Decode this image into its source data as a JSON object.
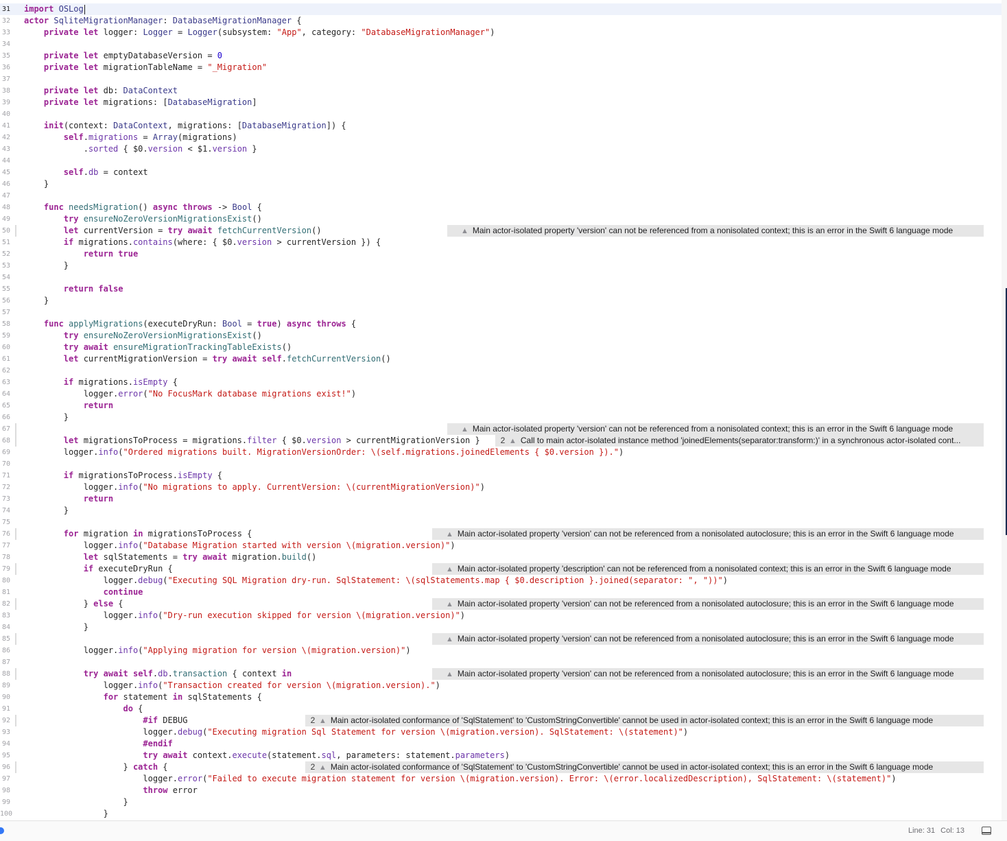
{
  "editor": {
    "current_line": 31,
    "lines": [
      {
        "n": 31,
        "t": "import OSLog",
        "cur": true
      },
      {
        "n": 32,
        "t": "actor SqliteMigrationManager: DatabaseMigrationManager {"
      },
      {
        "n": 33,
        "t": "    private let logger: Logger = Logger(subsystem: \"App\", category: \"DatabaseMigrationManager\")"
      },
      {
        "n": 34,
        "t": ""
      },
      {
        "n": 35,
        "t": "    private let emptyDatabaseVersion = 0"
      },
      {
        "n": 36,
        "t": "    private let migrationTableName = \"_Migration\""
      },
      {
        "n": 37,
        "t": ""
      },
      {
        "n": 38,
        "t": "    private let db: DataContext"
      },
      {
        "n": 39,
        "t": "    private let migrations: [DatabaseMigration]"
      },
      {
        "n": 40,
        "t": ""
      },
      {
        "n": 41,
        "t": "    init(context: DataContext, migrations: [DatabaseMigration]) {"
      },
      {
        "n": 42,
        "t": "        self.migrations = Array(migrations)"
      },
      {
        "n": 43,
        "t": "            .sorted { $0.version < $1.version }"
      },
      {
        "n": 44,
        "t": ""
      },
      {
        "n": 45,
        "t": "        self.db = context"
      },
      {
        "n": 46,
        "t": "    }"
      },
      {
        "n": 47,
        "t": ""
      },
      {
        "n": 48,
        "t": "    func needsMigration() async throws -> Bool {"
      },
      {
        "n": 49,
        "t": "        try ensureNoZeroVersionMigrationsExist()"
      },
      {
        "n": 50,
        "t": "        let currentVersion = try await fetchCurrentVersion()"
      },
      {
        "n": 51,
        "t": "        if migrations.contains(where: { $0.version > currentVersion }) {"
      },
      {
        "n": 52,
        "t": "            return true"
      },
      {
        "n": 53,
        "t": "        }"
      },
      {
        "n": 54,
        "t": ""
      },
      {
        "n": 55,
        "t": "        return false"
      },
      {
        "n": 56,
        "t": "    }"
      },
      {
        "n": 57,
        "t": ""
      },
      {
        "n": 58,
        "t": "    func applyMigrations(executeDryRun: Bool = true) async throws {"
      },
      {
        "n": 59,
        "t": "        try ensureNoZeroVersionMigrationsExist()"
      },
      {
        "n": 60,
        "t": "        try await ensureMigrationTrackingTableExists()"
      },
      {
        "n": 61,
        "t": "        let currentMigrationVersion = try await self.fetchCurrentVersion()"
      },
      {
        "n": 62,
        "t": ""
      },
      {
        "n": 63,
        "t": "        if migrations.isEmpty {"
      },
      {
        "n": 64,
        "t": "            logger.error(\"No FocusMark database migrations exist!\")"
      },
      {
        "n": 65,
        "t": "            return"
      },
      {
        "n": 66,
        "t": "        }"
      },
      {
        "n": 67,
        "t": ""
      },
      {
        "n": 68,
        "t": "        let migrationsToProcess = migrations.filter { $0.version > currentMigrationVersion }"
      },
      {
        "n": 69,
        "t": "        logger.info(\"Ordered migrations built. MigrationVersionOrder: \\(self.migrations.joinedElements { $0.version }).\")"
      },
      {
        "n": 70,
        "t": ""
      },
      {
        "n": 71,
        "t": "        if migrationsToProcess.isEmpty {"
      },
      {
        "n": 72,
        "t": "            logger.info(\"No migrations to apply. CurrentVersion: \\(currentMigrationVersion)\")"
      },
      {
        "n": 73,
        "t": "            return"
      },
      {
        "n": 74,
        "t": "        }"
      },
      {
        "n": 75,
        "t": ""
      },
      {
        "n": 76,
        "t": "        for migration in migrationsToProcess {"
      },
      {
        "n": 77,
        "t": "            logger.info(\"Database Migration started with version \\(migration.version)\")"
      },
      {
        "n": 78,
        "t": "            let sqlStatements = try await migration.build()"
      },
      {
        "n": 79,
        "t": "            if executeDryRun {"
      },
      {
        "n": 80,
        "t": "                logger.debug(\"Executing SQL Migration dry-run. SqlStatement: \\(sqlStatements.map { $0.description }.joined(separator: \", \"))\")"
      },
      {
        "n": 81,
        "t": "                continue"
      },
      {
        "n": 82,
        "t": "            } else {"
      },
      {
        "n": 83,
        "t": "                logger.info(\"Dry-run execution skipped for version \\(migration.version)\")"
      },
      {
        "n": 84,
        "t": "            }"
      },
      {
        "n": 85,
        "t": ""
      },
      {
        "n": 86,
        "t": "            logger.info(\"Applying migration for version \\(migration.version)\")"
      },
      {
        "n": 87,
        "t": ""
      },
      {
        "n": 88,
        "t": "            try await self.db.transaction { context in"
      },
      {
        "n": 89,
        "t": "                logger.info(\"Transaction created for version \\(migration.version).\")"
      },
      {
        "n": 90,
        "t": "                for statement in sqlStatements {"
      },
      {
        "n": 91,
        "t": "                    do {"
      },
      {
        "n": 92,
        "t": "                        #if DEBUG"
      },
      {
        "n": 93,
        "t": "                        logger.debug(\"Executing migration Sql Statement for version \\(migration.version). SqlStatement: \\(statement)\")"
      },
      {
        "n": 94,
        "t": "                        #endif"
      },
      {
        "n": 95,
        "t": "                        try await context.execute(statement.sql, parameters: statement.parameters)"
      },
      {
        "n": 96,
        "t": "                    } catch {"
      },
      {
        "n": 97,
        "t": "                        logger.error(\"Failed to execute migration statement for version \\(migration.version). Error: \\(error.localizedDescription), SqlStatement: \\(statement)\")"
      },
      {
        "n": 98,
        "t": "                        throw error"
      },
      {
        "n": 99,
        "t": "                    }"
      },
      {
        "n": 100,
        "t": "                }"
      }
    ],
    "issues": [
      {
        "line": 50,
        "count": "",
        "text": "Main actor-isolated property 'version' can not be referenced from a nonisolated context; this is an error in the Swift 6 language mode"
      },
      {
        "line": 67,
        "count": "",
        "text": "Main actor-isolated property 'version' can not be referenced from a nonisolated context; this is an error in the Swift 6 language mode"
      },
      {
        "line": 68,
        "count": "2",
        "text": "Call to main actor-isolated instance method 'joinedElements(separator:transform:)' in a synchronous actor-isolated cont..."
      },
      {
        "line": 76,
        "count": "",
        "text": "Main actor-isolated property 'version' can not be referenced from a nonisolated autoclosure; this is an error in the Swift 6 language mode"
      },
      {
        "line": 79,
        "count": "",
        "text": "Main actor-isolated property 'description' can not be referenced from a nonisolated context; this is an error in the Swift 6 language mode"
      },
      {
        "line": 82,
        "count": "",
        "text": "Main actor-isolated property 'version' can not be referenced from a nonisolated autoclosure; this is an error in the Swift 6 language mode"
      },
      {
        "line": 85,
        "count": "",
        "text": "Main actor-isolated property 'version' can not be referenced from a nonisolated autoclosure; this is an error in the Swift 6 language mode"
      },
      {
        "line": 88,
        "count": "",
        "text": "Main actor-isolated property 'version' can not be referenced from a nonisolated autoclosure; this is an error in the Swift 6 language mode"
      },
      {
        "line": 92,
        "count": "2",
        "text": "Main actor-isolated conformance of 'SqlStatement' to 'CustomStringConvertible' cannot be used in actor-isolated context; this is an error in the Swift 6 language mode"
      },
      {
        "line": 96,
        "count": "2",
        "text": "Main actor-isolated conformance of 'SqlStatement' to 'CustomStringConvertible' cannot be used in actor-isolated context; this is an error in the Swift 6 language mode"
      }
    ],
    "warning_icon": "warning-triangle-icon"
  },
  "status": {
    "line_text": "Line: 31",
    "col_text": "Col: 13",
    "panel_icon": "bottom-panel-toggle-icon"
  },
  "colors": {
    "keyword": "#9b2393",
    "string": "#c41a16",
    "number": "#1c00cf",
    "type": "#3a3a8a",
    "function": "#326d74",
    "property": "#6c36a9",
    "issue_bg": "#e6e6e6",
    "current_line_bg": "#eef2fb"
  }
}
